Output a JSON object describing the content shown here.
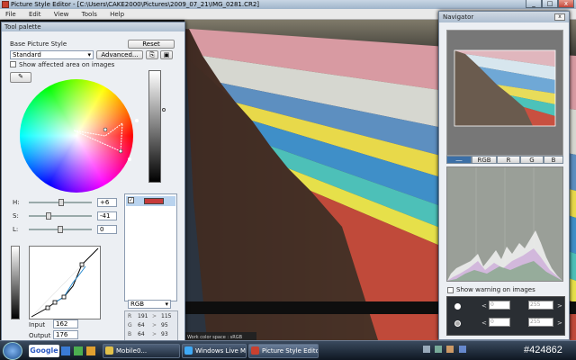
{
  "window": {
    "title": "Picture Style Editor - [C:\\Users\\CAKE2000\\Pictures\\2009_07_21\\IMG_0281.CR2]",
    "minimize": "_",
    "maximize": "□",
    "close": "x"
  },
  "menu": [
    "File",
    "Edit",
    "View",
    "Tools",
    "Help"
  ],
  "tool_palette": {
    "title": "Tool palette",
    "base_style_label": "Base Picture Style",
    "reset_label": "Reset",
    "style_value": "Standard",
    "advanced_label": "Advanced...",
    "show_affected_label": "Show affected area on images",
    "h_label": "H:",
    "s_label": "S:",
    "l_label": "L:",
    "h_value": "+6",
    "s_value": "-41",
    "l_value": "0",
    "h_level": 0.52,
    "s_level": 0.3,
    "l_level": 0.5,
    "input_label": "Input",
    "input_value": "162",
    "output_label": "Output",
    "output_value": "176",
    "rgb_select": "RGB",
    "readout": [
      {
        "ch": "R",
        "a": "191",
        "b": "115"
      },
      {
        "ch": "G",
        "a": "64",
        "b": "95"
      },
      {
        "ch": "B",
        "a": "64",
        "b": "93"
      }
    ],
    "arrow": ">",
    "color_swatch": "#c63b3b"
  },
  "navigator": {
    "title": "Navigator",
    "tabs": [
      "RGB",
      "R",
      "G",
      "B"
    ],
    "show_warning_label": "Show warning on images",
    "warn_rows": [
      {
        "lo": "0",
        "hi": "255"
      },
      {
        "lo": "0",
        "hi": "255"
      }
    ],
    "lt": "<",
    "gt": ">"
  },
  "status": {
    "color_space": "Work color space : sRGB"
  },
  "taskbar": {
    "search_logo": "Google",
    "tasks": [
      "Mobile0...",
      "Windows Live Mes...",
      "Picture Style Editor..."
    ],
    "watermark": "#424862"
  }
}
